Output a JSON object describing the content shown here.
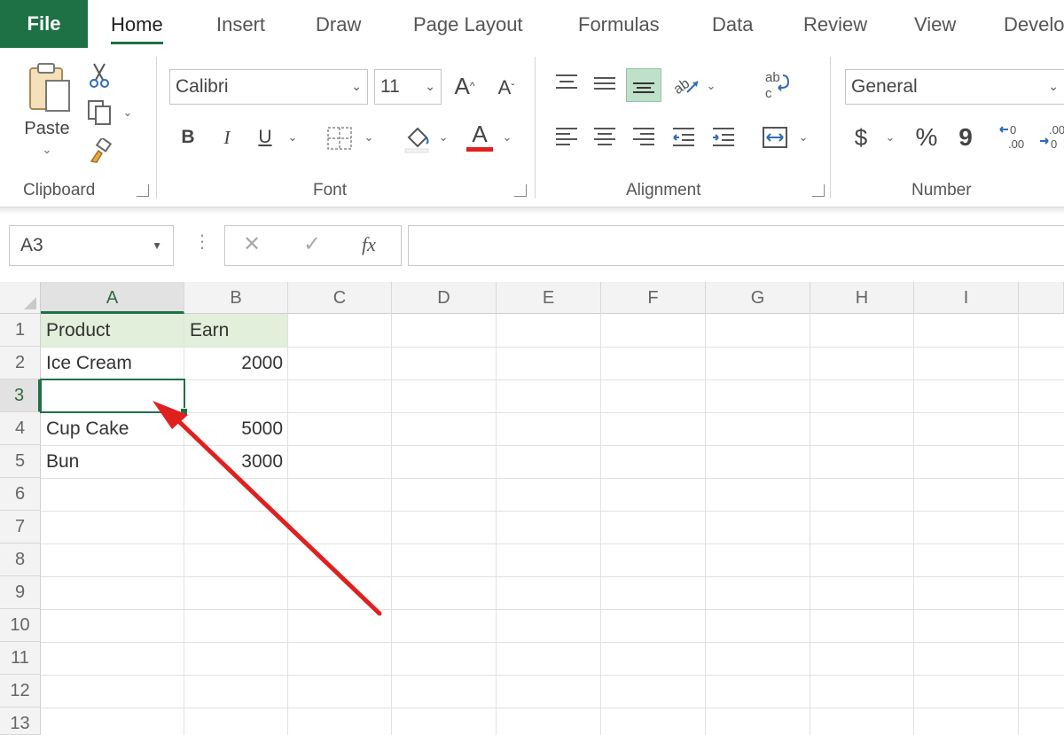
{
  "tabs": [
    {
      "label": "File"
    },
    {
      "label": "Home"
    },
    {
      "label": "Insert"
    },
    {
      "label": "Draw"
    },
    {
      "label": "Page Layout"
    },
    {
      "label": "Formulas"
    },
    {
      "label": "Data"
    },
    {
      "label": "Review"
    },
    {
      "label": "View"
    },
    {
      "label": "Develo"
    }
  ],
  "ribbon": {
    "clipboard": {
      "label": "Clipboard",
      "paste_label": "Paste"
    },
    "font": {
      "label": "Font",
      "font_name": "Calibri",
      "font_size": "11",
      "bold": "B",
      "italic": "I",
      "underline": "U",
      "font_color_glyph": "A"
    },
    "alignment": {
      "label": "Alignment"
    },
    "number": {
      "label": "Number",
      "format": "General",
      "currency": "$",
      "percent": "%",
      "comma": "9"
    }
  },
  "formula_bar": {
    "name_box": "A3",
    "dots": "⋮",
    "cancel": "✕",
    "enter": "✓",
    "fx": "fx",
    "value": ""
  },
  "sheet": {
    "columns": [
      "A",
      "B",
      "C",
      "D",
      "E",
      "F",
      "G",
      "H",
      "I"
    ],
    "rows": [
      "1",
      "2",
      "3",
      "4",
      "5",
      "6",
      "7",
      "8",
      "9",
      "10",
      "11",
      "12",
      "13"
    ],
    "cells": {
      "A1": "Product",
      "B1": "Earn",
      "A2": "Ice Cream",
      "B2": "2000",
      "A3": "",
      "B3": "",
      "A4": "Cup Cake",
      "B4": "5000",
      "A5": "Bun",
      "B5": "3000"
    },
    "selected_cell": "A3"
  },
  "colors": {
    "accent": "#1e7145",
    "header_fill": "#e2efda",
    "arrow": "#e0201f",
    "font_color_bar": "#e0201f"
  },
  "icons": [
    "paste-icon",
    "cut-icon",
    "copy-icon",
    "format-painter-icon",
    "increase-font-icon",
    "decrease-font-icon",
    "borders-icon",
    "fill-color-icon",
    "font-color-icon",
    "align-top-icon",
    "align-middle-icon",
    "align-bottom-icon",
    "orientation-icon",
    "align-left-icon",
    "align-center-icon",
    "align-right-icon",
    "decrease-indent-icon",
    "increase-indent-icon",
    "wrap-text-icon",
    "merge-center-icon",
    "increase-decimal-icon",
    "decrease-decimal-icon"
  ]
}
